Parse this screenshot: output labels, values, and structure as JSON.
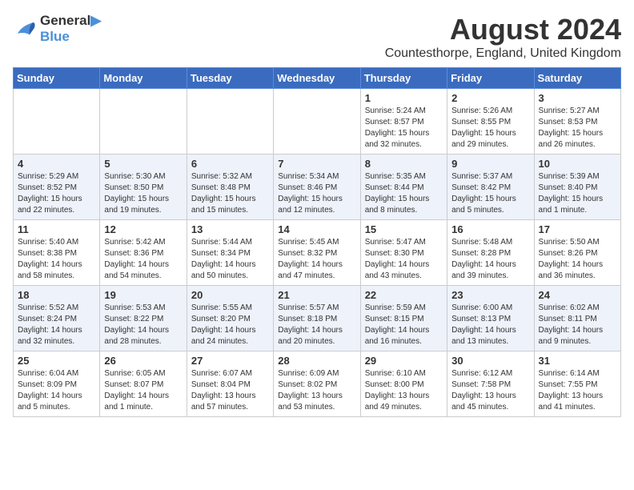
{
  "header": {
    "logo_line1": "General",
    "logo_line2": "Blue",
    "main_title": "August 2024",
    "subtitle": "Countesthorpe, England, United Kingdom"
  },
  "calendar": {
    "days_of_week": [
      "Sunday",
      "Monday",
      "Tuesday",
      "Wednesday",
      "Thursday",
      "Friday",
      "Saturday"
    ],
    "weeks": [
      [
        {
          "day": "",
          "info": ""
        },
        {
          "day": "",
          "info": ""
        },
        {
          "day": "",
          "info": ""
        },
        {
          "day": "",
          "info": ""
        },
        {
          "day": "1",
          "info": "Sunrise: 5:24 AM\nSunset: 8:57 PM\nDaylight: 15 hours\nand 32 minutes."
        },
        {
          "day": "2",
          "info": "Sunrise: 5:26 AM\nSunset: 8:55 PM\nDaylight: 15 hours\nand 29 minutes."
        },
        {
          "day": "3",
          "info": "Sunrise: 5:27 AM\nSunset: 8:53 PM\nDaylight: 15 hours\nand 26 minutes."
        }
      ],
      [
        {
          "day": "4",
          "info": "Sunrise: 5:29 AM\nSunset: 8:52 PM\nDaylight: 15 hours\nand 22 minutes."
        },
        {
          "day": "5",
          "info": "Sunrise: 5:30 AM\nSunset: 8:50 PM\nDaylight: 15 hours\nand 19 minutes."
        },
        {
          "day": "6",
          "info": "Sunrise: 5:32 AM\nSunset: 8:48 PM\nDaylight: 15 hours\nand 15 minutes."
        },
        {
          "day": "7",
          "info": "Sunrise: 5:34 AM\nSunset: 8:46 PM\nDaylight: 15 hours\nand 12 minutes."
        },
        {
          "day": "8",
          "info": "Sunrise: 5:35 AM\nSunset: 8:44 PM\nDaylight: 15 hours\nand 8 minutes."
        },
        {
          "day": "9",
          "info": "Sunrise: 5:37 AM\nSunset: 8:42 PM\nDaylight: 15 hours\nand 5 minutes."
        },
        {
          "day": "10",
          "info": "Sunrise: 5:39 AM\nSunset: 8:40 PM\nDaylight: 15 hours\nand 1 minute."
        }
      ],
      [
        {
          "day": "11",
          "info": "Sunrise: 5:40 AM\nSunset: 8:38 PM\nDaylight: 14 hours\nand 58 minutes."
        },
        {
          "day": "12",
          "info": "Sunrise: 5:42 AM\nSunset: 8:36 PM\nDaylight: 14 hours\nand 54 minutes."
        },
        {
          "day": "13",
          "info": "Sunrise: 5:44 AM\nSunset: 8:34 PM\nDaylight: 14 hours\nand 50 minutes."
        },
        {
          "day": "14",
          "info": "Sunrise: 5:45 AM\nSunset: 8:32 PM\nDaylight: 14 hours\nand 47 minutes."
        },
        {
          "day": "15",
          "info": "Sunrise: 5:47 AM\nSunset: 8:30 PM\nDaylight: 14 hours\nand 43 minutes."
        },
        {
          "day": "16",
          "info": "Sunrise: 5:48 AM\nSunset: 8:28 PM\nDaylight: 14 hours\nand 39 minutes."
        },
        {
          "day": "17",
          "info": "Sunrise: 5:50 AM\nSunset: 8:26 PM\nDaylight: 14 hours\nand 36 minutes."
        }
      ],
      [
        {
          "day": "18",
          "info": "Sunrise: 5:52 AM\nSunset: 8:24 PM\nDaylight: 14 hours\nand 32 minutes."
        },
        {
          "day": "19",
          "info": "Sunrise: 5:53 AM\nSunset: 8:22 PM\nDaylight: 14 hours\nand 28 minutes."
        },
        {
          "day": "20",
          "info": "Sunrise: 5:55 AM\nSunset: 8:20 PM\nDaylight: 14 hours\nand 24 minutes."
        },
        {
          "day": "21",
          "info": "Sunrise: 5:57 AM\nSunset: 8:18 PM\nDaylight: 14 hours\nand 20 minutes."
        },
        {
          "day": "22",
          "info": "Sunrise: 5:59 AM\nSunset: 8:15 PM\nDaylight: 14 hours\nand 16 minutes."
        },
        {
          "day": "23",
          "info": "Sunrise: 6:00 AM\nSunset: 8:13 PM\nDaylight: 14 hours\nand 13 minutes."
        },
        {
          "day": "24",
          "info": "Sunrise: 6:02 AM\nSunset: 8:11 PM\nDaylight: 14 hours\nand 9 minutes."
        }
      ],
      [
        {
          "day": "25",
          "info": "Sunrise: 6:04 AM\nSunset: 8:09 PM\nDaylight: 14 hours\nand 5 minutes."
        },
        {
          "day": "26",
          "info": "Sunrise: 6:05 AM\nSunset: 8:07 PM\nDaylight: 14 hours\nand 1 minute."
        },
        {
          "day": "27",
          "info": "Sunrise: 6:07 AM\nSunset: 8:04 PM\nDaylight: 13 hours\nand 57 minutes."
        },
        {
          "day": "28",
          "info": "Sunrise: 6:09 AM\nSunset: 8:02 PM\nDaylight: 13 hours\nand 53 minutes."
        },
        {
          "day": "29",
          "info": "Sunrise: 6:10 AM\nSunset: 8:00 PM\nDaylight: 13 hours\nand 49 minutes."
        },
        {
          "day": "30",
          "info": "Sunrise: 6:12 AM\nSunset: 7:58 PM\nDaylight: 13 hours\nand 45 minutes."
        },
        {
          "day": "31",
          "info": "Sunrise: 6:14 AM\nSunset: 7:55 PM\nDaylight: 13 hours\nand 41 minutes."
        }
      ]
    ]
  }
}
